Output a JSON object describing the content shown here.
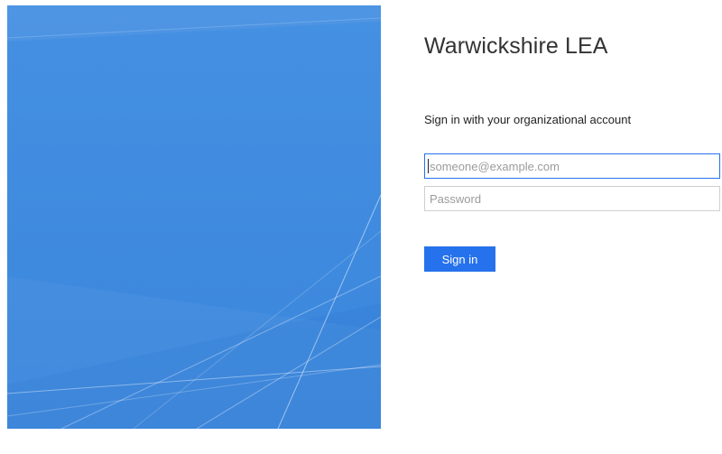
{
  "organization": {
    "name": "Warwickshire LEA"
  },
  "login": {
    "heading": "Sign in with your organizational account",
    "email_placeholder": "someone@example.com",
    "email_value": "",
    "password_placeholder": "Password",
    "password_value": "",
    "submit_label": "Sign in"
  },
  "colors": {
    "illustration_blue": "#3f8be0",
    "accent_blue": "#2672ec",
    "input_border": "#cfcfcf"
  }
}
